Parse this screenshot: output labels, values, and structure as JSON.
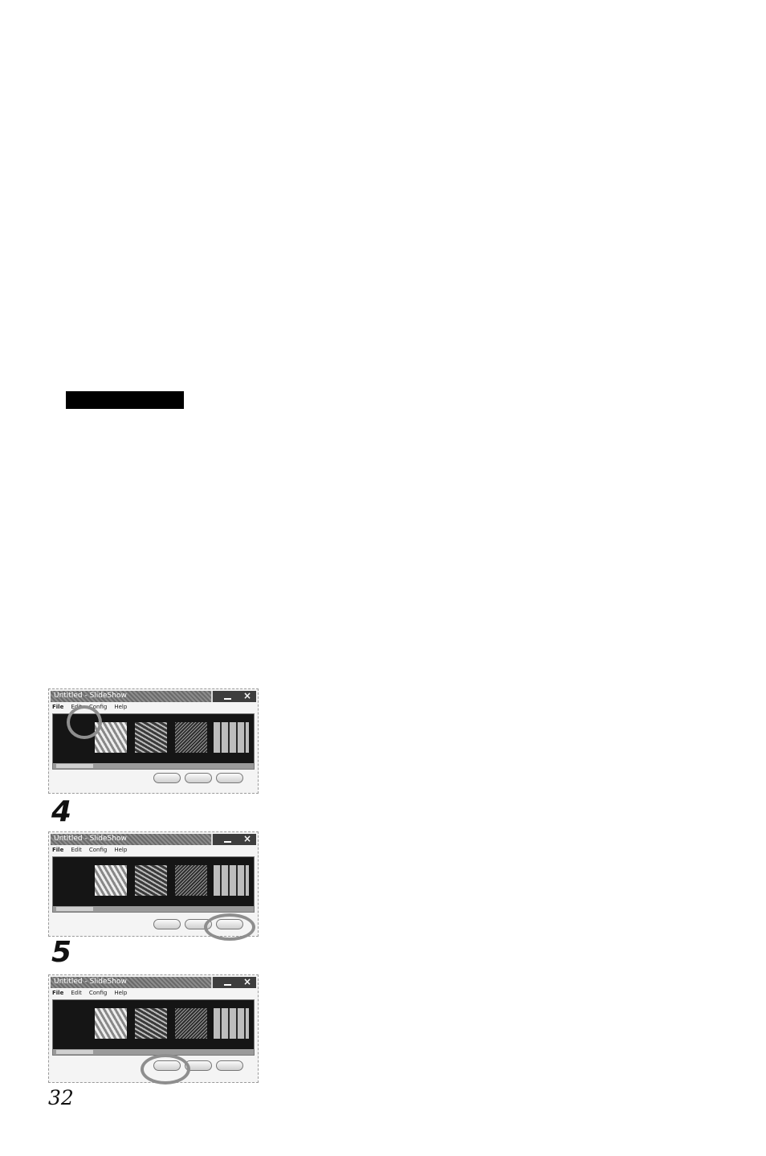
{
  "window": {
    "title": "Untitled - SlideShow",
    "menu": [
      "File",
      "Edit",
      "Config",
      "Help"
    ]
  },
  "steps": {
    "step4": "4",
    "step5": "5"
  },
  "page_number": "32",
  "icons": [
    "minimize-icon",
    "close-icon"
  ],
  "colors": {
    "highlight_circle": "#8e8e8e",
    "title_bar": "#6a6a6a"
  }
}
